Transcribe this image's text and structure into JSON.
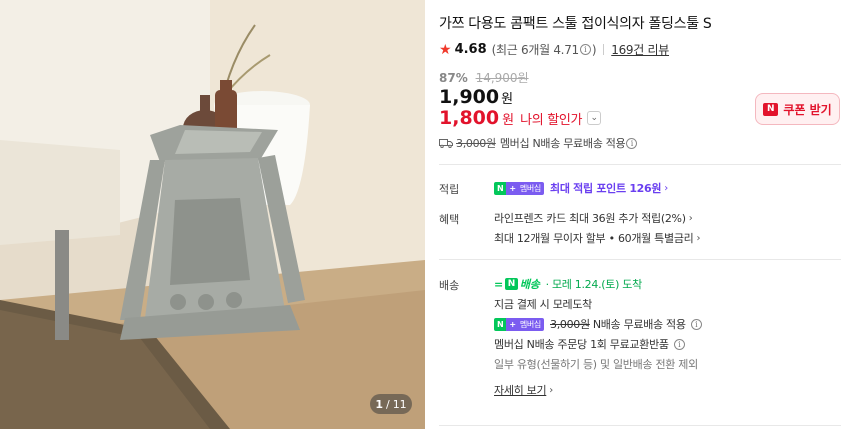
{
  "product": {
    "title": "가쯔 다용도 콤팩트 스툴 접이식의자 폴딩스툴 S",
    "rating": "4.68",
    "recent_rating_text": "(최근 6개월 4.71",
    "recent_rating_close": ")",
    "reviews_text": "169건 리뷰",
    "discount_pct": "87%",
    "original_price": "14,900원",
    "price": "1,900",
    "price_unit": "원",
    "my_price": "1,800",
    "my_price_unit": "원",
    "my_price_label": "나의 할인가",
    "coupon_label": "쿠폰 받기",
    "coupon_badge": "N",
    "shipping_fee_strike": "3,000원",
    "shipping_text": "멤버십 N배송 무료배송 적용"
  },
  "gallery": {
    "current": "1",
    "separator": "/",
    "total": "11"
  },
  "points": {
    "label": "적립",
    "badge_n": "N",
    "badge_plus": "+",
    "badge_membership": "멤버십",
    "text": "최대 적립 포인트 126원"
  },
  "benefits": {
    "label": "혜택",
    "line1": "라인프렌즈 카드 최대 36원 추가 적립(2%)",
    "line2": "최대 12개월 무이자 할부 • 60개월 특별금리"
  },
  "delivery": {
    "label": "배송",
    "n_badge_text": "배송",
    "arrival": "· 모레 1.24.(토) 도착",
    "pay_line": "지금 결제 시 모레도착",
    "badge_n": "N",
    "badge_plus": "+",
    "badge_membership": "멤버십",
    "fee_strike": "3,000원",
    "fee_text": "N배송 무료배송 적용",
    "exchange": "멤버십 N배송 주문당 1회 무료교환반품",
    "exception": "일부 유형(선물하기 등) 및 일반배송 전환 제외",
    "details_link": "자세히 보기"
  },
  "icons": {
    "star": "star-icon",
    "info": "info-icon",
    "chevron": "chevron-icon",
    "truck": "truck-icon"
  },
  "colors": {
    "accent_red": "#e2132c",
    "naver_green": "#03c75a",
    "membership_purple": "#6a3ff0"
  }
}
